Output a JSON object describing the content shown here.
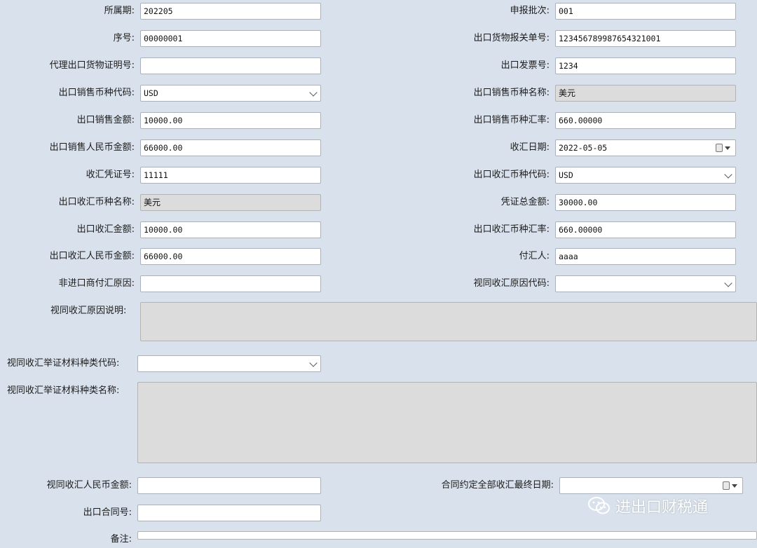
{
  "form": {
    "period": {
      "label": "所属期:",
      "value": "202205"
    },
    "batch": {
      "label": "申报批次:",
      "value": "001"
    },
    "seq": {
      "label": "序号:",
      "value": "00000001"
    },
    "customs_no": {
      "label": "出口货物报关单号:",
      "value": "123456789987654321001"
    },
    "agency_cert": {
      "label": "代理出口货物证明号:",
      "value": ""
    },
    "invoice_no": {
      "label": "出口发票号:",
      "value": "1234"
    },
    "sale_curr_code": {
      "label": "出口销售币种代码:",
      "value": "USD"
    },
    "sale_curr_name": {
      "label": "出口销售币种名称:",
      "value": "美元"
    },
    "sale_amount": {
      "label": "出口销售金额:",
      "value": "10000.00"
    },
    "sale_rate": {
      "label": "出口销售币种汇率:",
      "value": "660.00000"
    },
    "sale_rmb": {
      "label": "出口销售人民币金额:",
      "value": "66000.00"
    },
    "recv_date": {
      "label": "收汇日期:",
      "value": "2022-05-05"
    },
    "voucher_no": {
      "label": "收汇凭证号:",
      "value": "11111"
    },
    "recv_curr_code": {
      "label": "出口收汇币种代码:",
      "value": "USD"
    },
    "recv_curr_name": {
      "label": "出口收汇币种名称:",
      "value": "美元"
    },
    "voucher_total": {
      "label": "凭证总金额:",
      "value": "30000.00"
    },
    "recv_amount": {
      "label": "出口收汇金额:",
      "value": "10000.00"
    },
    "recv_rate": {
      "label": "出口收汇币种汇率:",
      "value": "660.00000"
    },
    "recv_rmb": {
      "label": "出口收汇人民币金额:",
      "value": "66000.00"
    },
    "payer": {
      "label": "付汇人:",
      "value": "aaaa"
    },
    "non_importer_reason": {
      "label": "非进口商付汇原因:",
      "value": ""
    },
    "deemed_reason_code": {
      "label": "视同收汇原因代码:",
      "value": ""
    },
    "deemed_reason_desc": {
      "label": "视同收汇原因说明:"
    },
    "proof_type_code": {
      "label": "视同收汇举证材料种类代码:",
      "value": ""
    },
    "proof_type_name": {
      "label": "视同收汇举证材料种类名称:"
    },
    "deemed_rmb": {
      "label": "视同收汇人民币金额:",
      "value": ""
    },
    "contract_final_date": {
      "label": "合同约定全部收汇最终日期:",
      "value": ""
    },
    "contract_no": {
      "label": "出口合同号:",
      "value": ""
    },
    "remark": {
      "label": "备注:"
    }
  },
  "watermark": {
    "text": "进出口财税通",
    "icon": "wechat-icon"
  }
}
